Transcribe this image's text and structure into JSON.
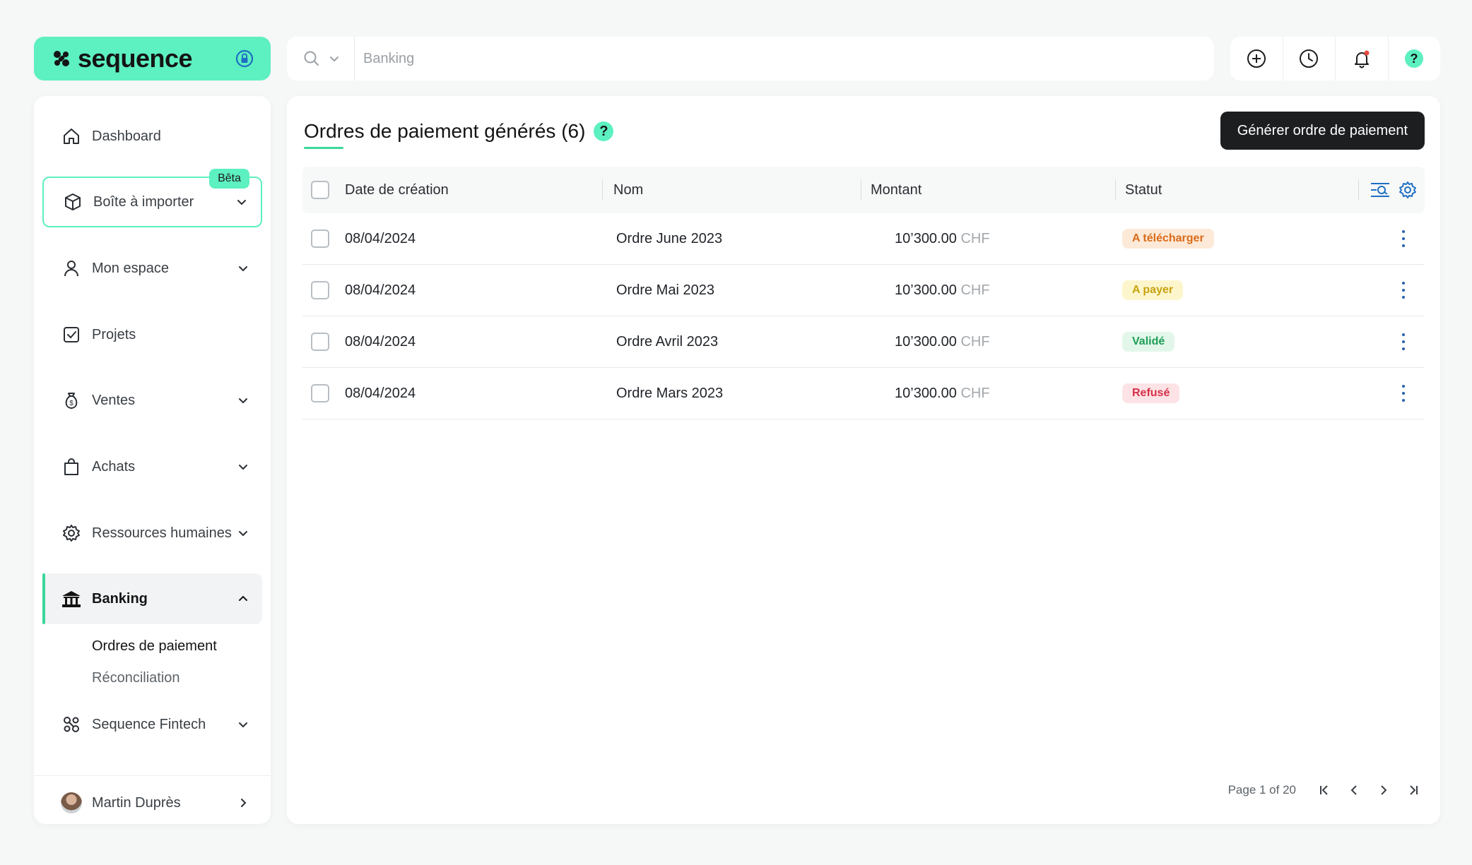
{
  "brand": {
    "name": "sequence",
    "accent": "#5df0c0"
  },
  "search": {
    "placeholder": "Banking"
  },
  "toolbar": {
    "icons": [
      "add-icon",
      "history-icon",
      "bell-icon",
      "help-icon"
    ]
  },
  "sidebar": {
    "beta_label": "Bêta",
    "items": [
      {
        "label": "Dashboard",
        "icon": "home-icon"
      },
      {
        "label": "Boîte à importer",
        "icon": "box-icon"
      },
      {
        "label": "Mon espace",
        "icon": "user-icon"
      },
      {
        "label": "Projets",
        "icon": "checkbox-icon"
      },
      {
        "label": "Ventes",
        "icon": "money-bag-icon"
      },
      {
        "label": "Achats",
        "icon": "shopping-bag-icon"
      },
      {
        "label": "Ressources humaines",
        "icon": "gear-icon"
      },
      {
        "label": "Banking",
        "icon": "bank-icon"
      },
      {
        "label": "Sequence Fintech",
        "icon": "fintech-icon"
      }
    ],
    "subitems": [
      "Ordres de paiement",
      "Réconciliation"
    ],
    "user": {
      "name": "Martin Duprès"
    }
  },
  "main": {
    "title": "Ordres de paiement générés (6)",
    "help": "?",
    "primary_button": "Générer ordre de paiement",
    "columns": [
      "Date de création",
      "Nom",
      "Montant",
      "Statut"
    ],
    "rows": [
      {
        "date": "08/04/2024",
        "name": "Ordre June 2023",
        "amount": "10’300.00",
        "currency": "CHF",
        "status": "A télécharger",
        "status_color": "orange"
      },
      {
        "date": "08/04/2024",
        "name": "Ordre Mai 2023",
        "amount": "10’300.00",
        "currency": "CHF",
        "status": "A payer",
        "status_color": "yellow"
      },
      {
        "date": "08/04/2024",
        "name": "Ordre Avril 2023",
        "amount": "10’300.00",
        "currency": "CHF",
        "status": "Validé",
        "status_color": "green"
      },
      {
        "date": "08/04/2024",
        "name": "Ordre Mars 2023",
        "amount": "10’300.00",
        "currency": "CHF",
        "status": "Refusé",
        "status_color": "red"
      }
    ],
    "pagination": {
      "label": "Page 1 of 20"
    }
  }
}
